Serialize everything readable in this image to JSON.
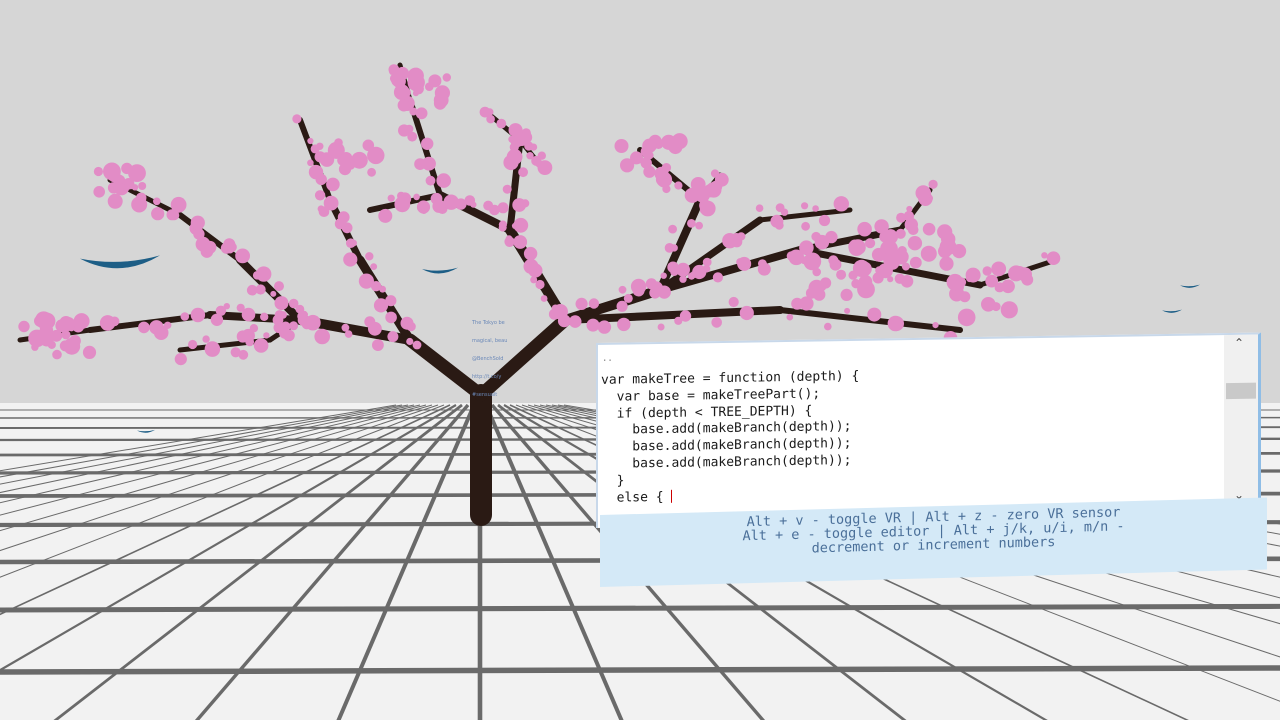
{
  "editor": {
    "top_marker": "..",
    "code_lines": [
      "var makeTree = function (depth) {",
      "  var base = makeTreePart();",
      "  if (depth < TREE_DEPTH) {",
      "    base.add(makeBranch(depth));",
      "    base.add(makeBranch(depth));",
      "    base.add(makeBranch(depth));",
      "  }",
      "  else { "
    ],
    "scroll_up_icon": "chevron-up-icon",
    "scroll_down_icon": "chevron-down-icon",
    "resize_grip": "::"
  },
  "help": {
    "lines": [
      "Alt + v - toggle VR | Alt + z - zero VR sensor",
      "Alt + e - toggle editor | Alt + j/k, u/i, m/n -",
      "decrement or increment numbers"
    ]
  },
  "scene": {
    "sky_color": "#d6d6d6",
    "floor_color": "#f2f2f2",
    "grid_color": "#6a6a6a",
    "trunk_color": "#2a1a14",
    "blossom_color": "#e28cc6",
    "bird_color": "#1d5e86"
  },
  "sign": {
    "lines": [
      "The Tokyo be",
      "magical, beau",
      "@BenchSold",
      "http://t.co/y",
      "#sensualt"
    ]
  }
}
